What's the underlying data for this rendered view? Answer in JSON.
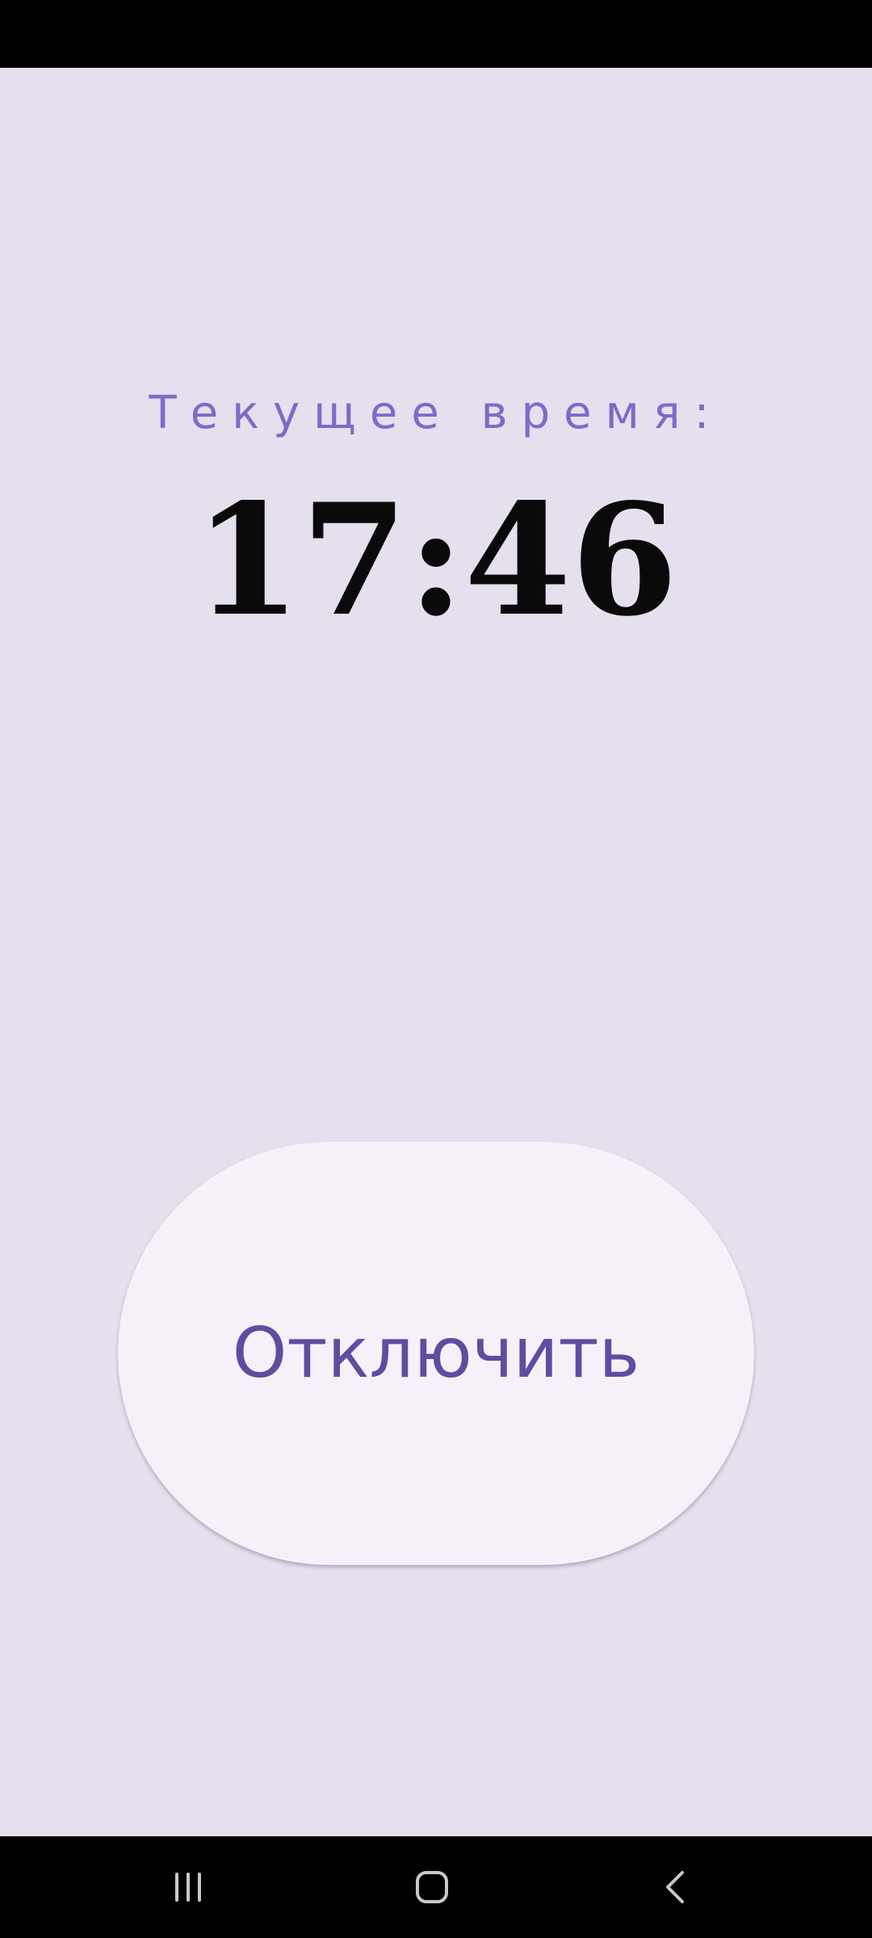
{
  "screen": {
    "time_label": "Текущее время:",
    "time_value": "17:46",
    "disable_button_label": "Отключить"
  },
  "nav_bar": {
    "icons": [
      "recents-icon",
      "home-icon",
      "back-icon"
    ]
  },
  "colors": {
    "background": "#e6dfed",
    "label": "#7d6bc9",
    "time": "#0a0a0a",
    "button_bg": "#f6f1f9",
    "button_text": "#5e4da0"
  }
}
